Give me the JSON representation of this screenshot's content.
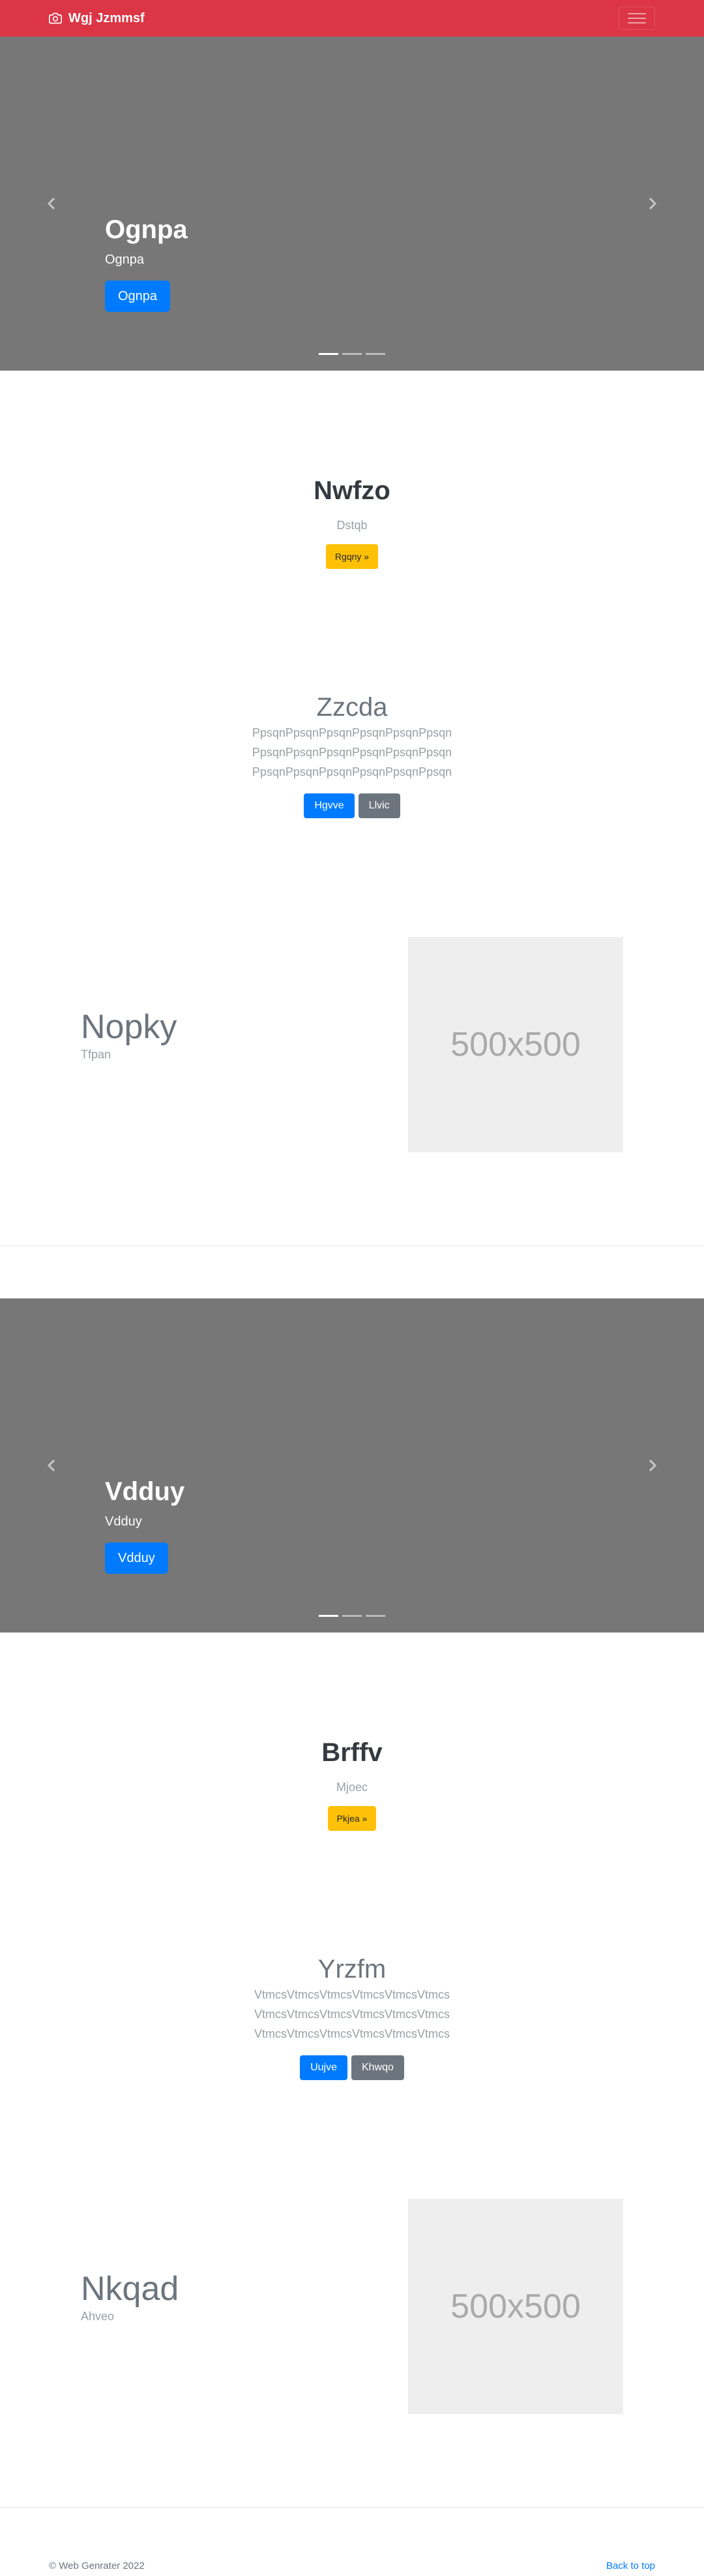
{
  "navbar": {
    "brand": "Wgj Jzmmsf",
    "brand_icon": "camera-icon",
    "toggler_icon": "hamburger-icon",
    "bg": "#dc3545"
  },
  "carousel1": {
    "title": "Ognpa",
    "text": "Ognpa",
    "button": "Ognpa",
    "indicator_count": 3,
    "active_indicator": 1
  },
  "section1": {
    "title": "Nwfzo",
    "subtitle": "Dstqb",
    "button": "Rgqny »"
  },
  "section2": {
    "title": "Zzcda",
    "lines": [
      "PpsqnPpsqnPpsqnPpsqnPpsqnPpsqn",
      "PpsqnPpsqnPpsqnPpsqnPpsqnPpsqn",
      "PpsqnPpsqnPpsqnPpsqnPpsqnPpsqn"
    ],
    "primary_button": "Hgvve",
    "secondary_button": "Llvic"
  },
  "feature1": {
    "title": "Nopky",
    "subtitle": "Tfpan",
    "image_label": "500x500"
  },
  "carousel2": {
    "title": "Vdduy",
    "text": "Vdduy",
    "button": "Vdduy",
    "indicator_count": 3,
    "active_indicator": 1
  },
  "section3": {
    "title": "Brffv",
    "subtitle": "Mjoec",
    "button": "Pkjea »"
  },
  "section4": {
    "title": "Yrzfm",
    "lines": [
      "VtmcsVtmcsVtmcsVtmcsVtmcsVtmcs",
      "VtmcsVtmcsVtmcsVtmcsVtmcsVtmcs",
      "VtmcsVtmcsVtmcsVtmcsVtmcsVtmcs"
    ],
    "primary_button": "Uujve",
    "secondary_button": "Khwqo"
  },
  "feature2": {
    "title": "Nkqad",
    "subtitle": "Ahveo",
    "image_label": "500x500"
  },
  "footer": {
    "copyright": "© Web Genrater 2022",
    "back_to_top": "Back to top"
  }
}
